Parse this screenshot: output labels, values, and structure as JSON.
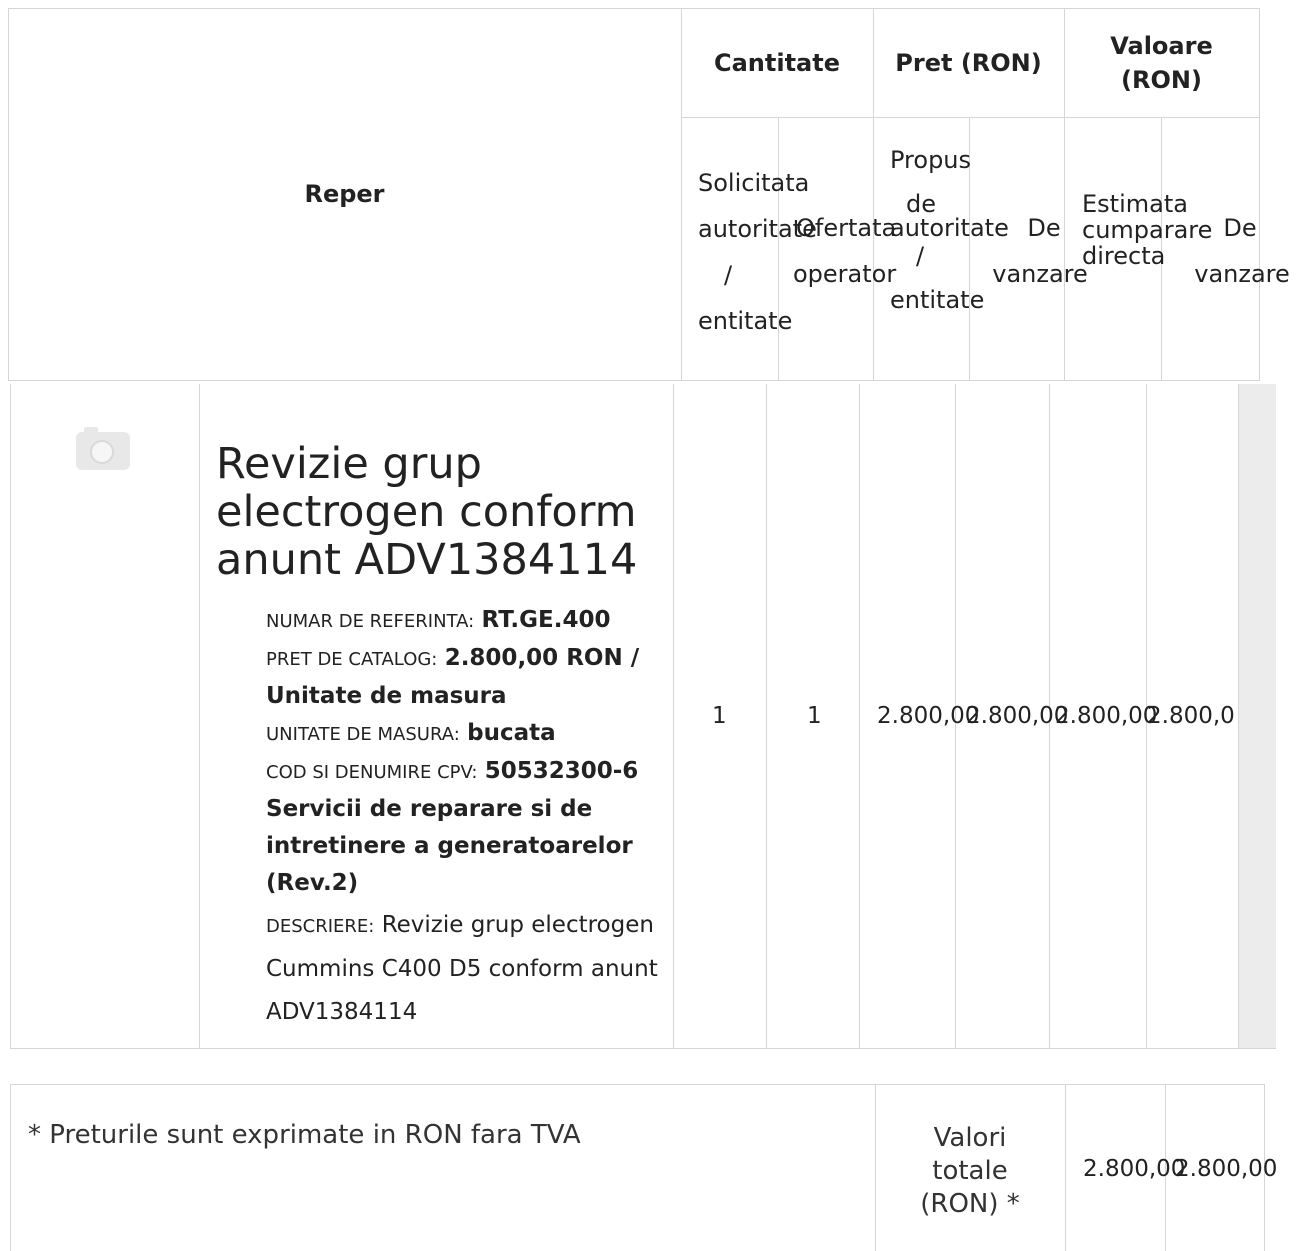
{
  "header": {
    "reper": "Reper",
    "cantitate": "Cantitate",
    "pret": "Pret (RON)",
    "valoare_line1": "Valoare",
    "valoare_line2": "(RON)"
  },
  "subheaders": {
    "solicitata": [
      "Solicitata",
      "autoritate",
      "/",
      "entitate"
    ],
    "ofertata": [
      "Ofertata",
      "operator"
    ],
    "propus": [
      "Propus",
      "de",
      "autoritate",
      "/",
      "entitate"
    ],
    "de_vanzare": [
      "De",
      "vanzare"
    ],
    "estimata": [
      "Estimata",
      "cumparare",
      "directa"
    ],
    "de_vanzare_2": [
      "De",
      "vanzare"
    ]
  },
  "item": {
    "image_icon": "camera-icon",
    "title": "Revizie grup electrogen conform anunt ADV1384114",
    "ref_label": "NUMAR DE REFERINTA:",
    "ref_value": "RT.GE.400",
    "price_label": "PRET DE CATALOG:",
    "price_value": "2.800,00  RON / Unitate de masura",
    "unit_label": "UNITATE DE MASURA:",
    "unit_value": "bucata",
    "cpv_label": "COD SI DENUMIRE CPV:",
    "cpv_value": "50532300-6 Servicii de reparare si de intretinere a generatoarelor (Rev.2)",
    "desc_label": "DESCRIERE:",
    "desc_value": "Revizie grup electrogen Cummins C400 D5 conform anunt ADV1384114",
    "solicitata": "1",
    "ofertata": "1",
    "pret_propus": "2.800,00",
    "pret_vanzare": "2.800,00",
    "val_estimata": "2.800,00",
    "val_vanzare": "2.800,0"
  },
  "footer": {
    "note": "* Preturile sunt exprimate in RON fara TVA",
    "totals_label": [
      "Valori",
      "totale",
      "(RON) *"
    ],
    "total_estimata": "2.800,00",
    "total_vanzare": "2.800,00"
  }
}
